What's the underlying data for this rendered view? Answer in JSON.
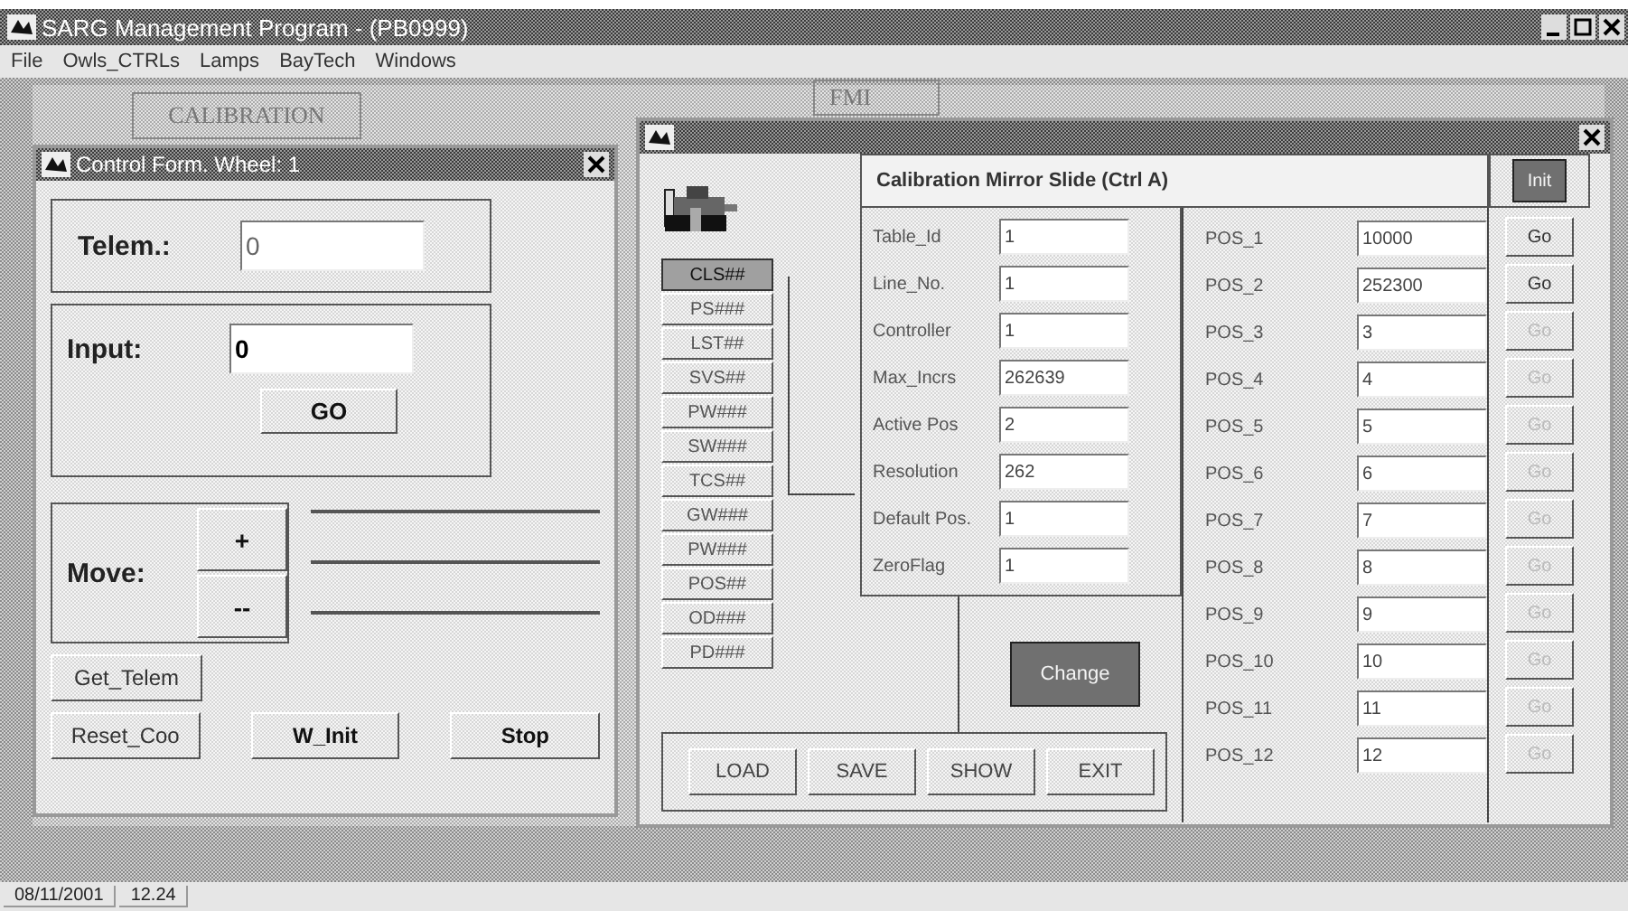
{
  "window": {
    "title": "SARG Management Program  -  (PB0999)"
  },
  "menu": [
    {
      "label": "File"
    },
    {
      "label": "Owls_CTRLs"
    },
    {
      "label": "Lamps"
    },
    {
      "label": "BayTech"
    },
    {
      "label": "Windows"
    }
  ],
  "background_tabs": [
    {
      "label": "CALIBRATION"
    },
    {
      "label": "FMI"
    }
  ],
  "control_form": {
    "title": "Control Form. Wheel: 1",
    "telem": {
      "label": "Telem.:",
      "value": "0",
      "disabled": true
    },
    "input": {
      "label": "Input:",
      "value": "0",
      "disabled": false
    },
    "go_button": "GO",
    "move": {
      "label": "Move:",
      "plus": "+",
      "minus": "--"
    },
    "buttons": [
      {
        "label": "Get_Telem",
        "bold": false
      },
      {
        "label": "Reset_Coo",
        "bold": false
      },
      {
        "label": "W_Init",
        "bold": true
      },
      {
        "label": "Stop",
        "bold": true
      }
    ]
  },
  "calibration_form": {
    "header": "Calibration Mirror Slide   (Ctrl A)",
    "init_button": "Init",
    "units": [
      {
        "label": "CLS##",
        "selected": true
      },
      {
        "label": "PS###",
        "selected": false
      },
      {
        "label": "LST##",
        "selected": false
      },
      {
        "label": "SVS##",
        "selected": false
      },
      {
        "label": "PW###",
        "selected": false
      },
      {
        "label": "SW###",
        "selected": false
      },
      {
        "label": "TCS##",
        "selected": false
      },
      {
        "label": "GW###",
        "selected": false
      },
      {
        "label": "PW###",
        "selected": false
      },
      {
        "label": "POS##",
        "selected": false
      },
      {
        "label": "OD###",
        "selected": false
      },
      {
        "label": "PD###",
        "selected": false
      }
    ],
    "fields": [
      {
        "label": "Table_Id",
        "value": "1"
      },
      {
        "label": "Line_No.",
        "value": "1"
      },
      {
        "label": "Controller",
        "value": "1"
      },
      {
        "label": "Max_Incrs",
        "value": "262639"
      },
      {
        "label": "Active Pos",
        "value": "2"
      },
      {
        "label": "Resolution",
        "value": "262"
      },
      {
        "label": "Default Pos.",
        "value": "1"
      },
      {
        "label": "ZeroFlag",
        "value": "1"
      }
    ],
    "positions": [
      {
        "label": "POS_1",
        "value": "10000",
        "go": "Go",
        "disabled": false
      },
      {
        "label": "POS_2",
        "value": "252300",
        "go": "Go",
        "disabled": false
      },
      {
        "label": "POS_3",
        "value": "3",
        "go": "Go",
        "disabled": true
      },
      {
        "label": "POS_4",
        "value": "4",
        "go": "Go",
        "disabled": true
      },
      {
        "label": "POS_5",
        "value": "5",
        "go": "Go",
        "disabled": true
      },
      {
        "label": "POS_6",
        "value": "6",
        "go": "Go",
        "disabled": true
      },
      {
        "label": "POS_7",
        "value": "7",
        "go": "Go",
        "disabled": true
      },
      {
        "label": "POS_8",
        "value": "8",
        "go": "Go",
        "disabled": true
      },
      {
        "label": "POS_9",
        "value": "9",
        "go": "Go",
        "disabled": true
      },
      {
        "label": "POS_10",
        "value": "10",
        "go": "Go",
        "disabled": true
      },
      {
        "label": "POS_11",
        "value": "11",
        "go": "Go",
        "disabled": true
      },
      {
        "label": "POS_12",
        "value": "12",
        "go": "Go",
        "disabled": true
      }
    ],
    "change_button": "Change",
    "bottom_buttons": [
      "LOAD",
      "SAVE",
      "SHOW",
      "EXIT"
    ]
  },
  "status_bar": [
    "08/11/2001",
    "12.24"
  ]
}
